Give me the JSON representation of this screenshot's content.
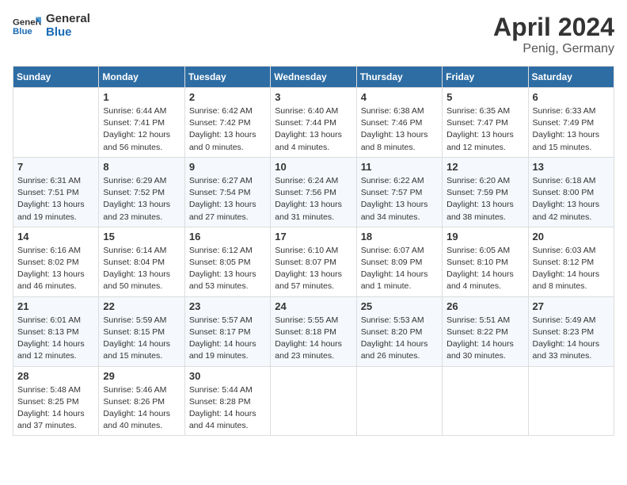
{
  "header": {
    "logo_line1": "General",
    "logo_line2": "Blue",
    "month": "April 2024",
    "location": "Penig, Germany"
  },
  "days_of_week": [
    "Sunday",
    "Monday",
    "Tuesday",
    "Wednesday",
    "Thursday",
    "Friday",
    "Saturday"
  ],
  "weeks": [
    [
      {
        "day": "",
        "sunrise": "",
        "sunset": "",
        "daylight": ""
      },
      {
        "day": "1",
        "sunrise": "Sunrise: 6:44 AM",
        "sunset": "Sunset: 7:41 PM",
        "daylight": "Daylight: 12 hours and 56 minutes."
      },
      {
        "day": "2",
        "sunrise": "Sunrise: 6:42 AM",
        "sunset": "Sunset: 7:42 PM",
        "daylight": "Daylight: 13 hours and 0 minutes."
      },
      {
        "day": "3",
        "sunrise": "Sunrise: 6:40 AM",
        "sunset": "Sunset: 7:44 PM",
        "daylight": "Daylight: 13 hours and 4 minutes."
      },
      {
        "day": "4",
        "sunrise": "Sunrise: 6:38 AM",
        "sunset": "Sunset: 7:46 PM",
        "daylight": "Daylight: 13 hours and 8 minutes."
      },
      {
        "day": "5",
        "sunrise": "Sunrise: 6:35 AM",
        "sunset": "Sunset: 7:47 PM",
        "daylight": "Daylight: 13 hours and 12 minutes."
      },
      {
        "day": "6",
        "sunrise": "Sunrise: 6:33 AM",
        "sunset": "Sunset: 7:49 PM",
        "daylight": "Daylight: 13 hours and 15 minutes."
      }
    ],
    [
      {
        "day": "7",
        "sunrise": "Sunrise: 6:31 AM",
        "sunset": "Sunset: 7:51 PM",
        "daylight": "Daylight: 13 hours and 19 minutes."
      },
      {
        "day": "8",
        "sunrise": "Sunrise: 6:29 AM",
        "sunset": "Sunset: 7:52 PM",
        "daylight": "Daylight: 13 hours and 23 minutes."
      },
      {
        "day": "9",
        "sunrise": "Sunrise: 6:27 AM",
        "sunset": "Sunset: 7:54 PM",
        "daylight": "Daylight: 13 hours and 27 minutes."
      },
      {
        "day": "10",
        "sunrise": "Sunrise: 6:24 AM",
        "sunset": "Sunset: 7:56 PM",
        "daylight": "Daylight: 13 hours and 31 minutes."
      },
      {
        "day": "11",
        "sunrise": "Sunrise: 6:22 AM",
        "sunset": "Sunset: 7:57 PM",
        "daylight": "Daylight: 13 hours and 34 minutes."
      },
      {
        "day": "12",
        "sunrise": "Sunrise: 6:20 AM",
        "sunset": "Sunset: 7:59 PM",
        "daylight": "Daylight: 13 hours and 38 minutes."
      },
      {
        "day": "13",
        "sunrise": "Sunrise: 6:18 AM",
        "sunset": "Sunset: 8:00 PM",
        "daylight": "Daylight: 13 hours and 42 minutes."
      }
    ],
    [
      {
        "day": "14",
        "sunrise": "Sunrise: 6:16 AM",
        "sunset": "Sunset: 8:02 PM",
        "daylight": "Daylight: 13 hours and 46 minutes."
      },
      {
        "day": "15",
        "sunrise": "Sunrise: 6:14 AM",
        "sunset": "Sunset: 8:04 PM",
        "daylight": "Daylight: 13 hours and 50 minutes."
      },
      {
        "day": "16",
        "sunrise": "Sunrise: 6:12 AM",
        "sunset": "Sunset: 8:05 PM",
        "daylight": "Daylight: 13 hours and 53 minutes."
      },
      {
        "day": "17",
        "sunrise": "Sunrise: 6:10 AM",
        "sunset": "Sunset: 8:07 PM",
        "daylight": "Daylight: 13 hours and 57 minutes."
      },
      {
        "day": "18",
        "sunrise": "Sunrise: 6:07 AM",
        "sunset": "Sunset: 8:09 PM",
        "daylight": "Daylight: 14 hours and 1 minute."
      },
      {
        "day": "19",
        "sunrise": "Sunrise: 6:05 AM",
        "sunset": "Sunset: 8:10 PM",
        "daylight": "Daylight: 14 hours and 4 minutes."
      },
      {
        "day": "20",
        "sunrise": "Sunrise: 6:03 AM",
        "sunset": "Sunset: 8:12 PM",
        "daylight": "Daylight: 14 hours and 8 minutes."
      }
    ],
    [
      {
        "day": "21",
        "sunrise": "Sunrise: 6:01 AM",
        "sunset": "Sunset: 8:13 PM",
        "daylight": "Daylight: 14 hours and 12 minutes."
      },
      {
        "day": "22",
        "sunrise": "Sunrise: 5:59 AM",
        "sunset": "Sunset: 8:15 PM",
        "daylight": "Daylight: 14 hours and 15 minutes."
      },
      {
        "day": "23",
        "sunrise": "Sunrise: 5:57 AM",
        "sunset": "Sunset: 8:17 PM",
        "daylight": "Daylight: 14 hours and 19 minutes."
      },
      {
        "day": "24",
        "sunrise": "Sunrise: 5:55 AM",
        "sunset": "Sunset: 8:18 PM",
        "daylight": "Daylight: 14 hours and 23 minutes."
      },
      {
        "day": "25",
        "sunrise": "Sunrise: 5:53 AM",
        "sunset": "Sunset: 8:20 PM",
        "daylight": "Daylight: 14 hours and 26 minutes."
      },
      {
        "day": "26",
        "sunrise": "Sunrise: 5:51 AM",
        "sunset": "Sunset: 8:22 PM",
        "daylight": "Daylight: 14 hours and 30 minutes."
      },
      {
        "day": "27",
        "sunrise": "Sunrise: 5:49 AM",
        "sunset": "Sunset: 8:23 PM",
        "daylight": "Daylight: 14 hours and 33 minutes."
      }
    ],
    [
      {
        "day": "28",
        "sunrise": "Sunrise: 5:48 AM",
        "sunset": "Sunset: 8:25 PM",
        "daylight": "Daylight: 14 hours and 37 minutes."
      },
      {
        "day": "29",
        "sunrise": "Sunrise: 5:46 AM",
        "sunset": "Sunset: 8:26 PM",
        "daylight": "Daylight: 14 hours and 40 minutes."
      },
      {
        "day": "30",
        "sunrise": "Sunrise: 5:44 AM",
        "sunset": "Sunset: 8:28 PM",
        "daylight": "Daylight: 14 hours and 44 minutes."
      },
      {
        "day": "",
        "sunrise": "",
        "sunset": "",
        "daylight": ""
      },
      {
        "day": "",
        "sunrise": "",
        "sunset": "",
        "daylight": ""
      },
      {
        "day": "",
        "sunrise": "",
        "sunset": "",
        "daylight": ""
      },
      {
        "day": "",
        "sunrise": "",
        "sunset": "",
        "daylight": ""
      }
    ]
  ]
}
